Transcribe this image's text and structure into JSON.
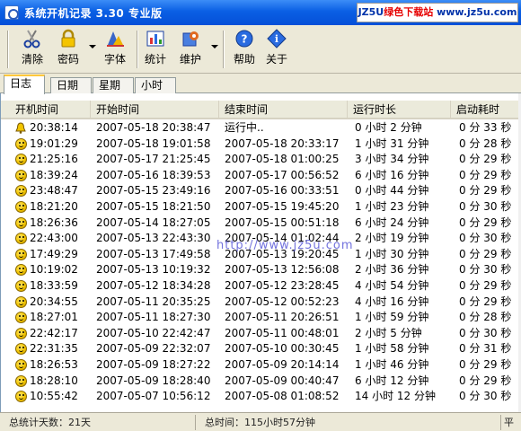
{
  "window": {
    "title": "系统开机记录 3.30 专业版",
    "watermark_a": "JZ5U",
    "watermark_b": "绿色下载站",
    "watermark_c": " www.jz5u.com"
  },
  "toolbar": {
    "clear": "清除",
    "password": "密码",
    "font": "字体",
    "stats": "统计",
    "maintain": "维护",
    "help": "帮助",
    "about": "关于"
  },
  "tabs": [
    "日志",
    "日期",
    "星期",
    "小时"
  ],
  "columns": [
    "开机时间",
    "开始时间",
    "结束时间",
    "运行时长",
    "启动耗时"
  ],
  "rows": [
    [
      "20:38:14",
      "2007-05-18 20:38:47",
      "运行中..",
      "0 小时  2 分钟",
      "0 分 33 秒"
    ],
    [
      "19:01:29",
      "2007-05-18 19:01:58",
      "2007-05-18 20:33:17",
      "1 小时 31 分钟",
      "0 分 28 秒"
    ],
    [
      "21:25:16",
      "2007-05-17 21:25:45",
      "2007-05-18 01:00:25",
      "3 小时 34 分钟",
      "0 分 29 秒"
    ],
    [
      "18:39:24",
      "2007-05-16 18:39:53",
      "2007-05-17 00:56:52",
      "6 小时 16 分钟",
      "0 分 29 秒"
    ],
    [
      "23:48:47",
      "2007-05-15 23:49:16",
      "2007-05-16 00:33:51",
      "0 小时 44 分钟",
      "0 分 29 秒"
    ],
    [
      "18:21:20",
      "2007-05-15 18:21:50",
      "2007-05-15 19:45:20",
      "1 小时 23 分钟",
      "0 分 30 秒"
    ],
    [
      "18:26:36",
      "2007-05-14 18:27:05",
      "2007-05-15 00:51:18",
      "6 小时 24 分钟",
      "0 分 29 秒"
    ],
    [
      "22:43:00",
      "2007-05-13 22:43:30",
      "2007-05-14 01:02:44",
      "2 小时 19 分钟",
      "0 分 30 秒"
    ],
    [
      "17:49:29",
      "2007-05-13 17:49:58",
      "2007-05-13 19:20:45",
      "1 小时 30 分钟",
      "0 分 29 秒"
    ],
    [
      "10:19:02",
      "2007-05-13 10:19:32",
      "2007-05-13 12:56:08",
      "2 小时 36 分钟",
      "0 分 30 秒"
    ],
    [
      "18:33:59",
      "2007-05-12 18:34:28",
      "2007-05-12 23:28:45",
      "4 小时 54 分钟",
      "0 分 29 秒"
    ],
    [
      "20:34:55",
      "2007-05-11 20:35:25",
      "2007-05-12 00:52:23",
      "4 小时 16 分钟",
      "0 分 29 秒"
    ],
    [
      "18:27:01",
      "2007-05-11 18:27:30",
      "2007-05-11 20:26:51",
      "1 小时 59 分钟",
      "0 分 28 秒"
    ],
    [
      "22:42:17",
      "2007-05-10 22:42:47",
      "2007-05-11 00:48:01",
      "2 小时  5 分钟",
      "0 分 30 秒"
    ],
    [
      "22:31:35",
      "2007-05-09 22:32:07",
      "2007-05-10 00:30:45",
      "1 小时 58 分钟",
      "0 分 31 秒"
    ],
    [
      "18:26:53",
      "2007-05-09 18:27:22",
      "2007-05-09 20:14:14",
      "1 小时 46 分钟",
      "0 分 29 秒"
    ],
    [
      "18:28:10",
      "2007-05-09 18:28:40",
      "2007-05-09 00:40:47",
      "6 小时 12 分钟",
      "0 分 29 秒"
    ],
    [
      "10:55:42",
      "2007-05-07 10:56:12",
      "2007-05-08 01:08:52",
      "14 小时 12 分钟",
      "0 分 30 秒"
    ]
  ],
  "overlay_url": "http://www.jz5u.com",
  "status": {
    "total_days": "总统计天数：21天",
    "total_time": "总时间：115小时57分钟",
    "avg": "平均"
  }
}
